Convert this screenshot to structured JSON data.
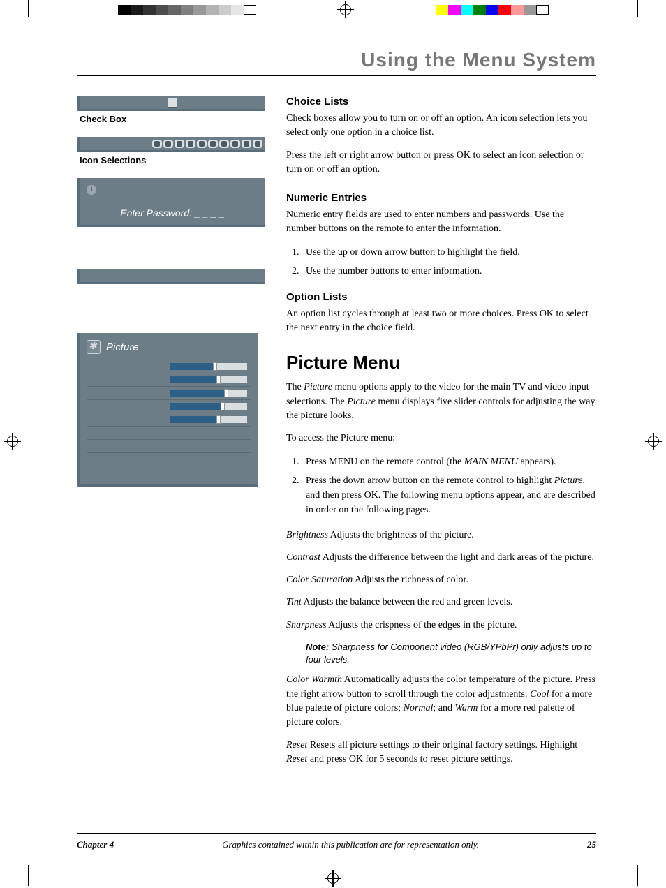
{
  "chapter_title": "Using the Menu System",
  "widgets": {
    "checkbox_caption": "Check Box",
    "icon_caption": "Icon Selections",
    "password_label": "Enter Password: _ _ _ _"
  },
  "picture_widget": {
    "title": "Picture",
    "sliders": [
      55,
      60,
      70,
      65,
      60
    ]
  },
  "sections": {
    "choice": {
      "heading": "Choice Lists",
      "p1": "Check boxes allow you to turn on or off an option. An icon selection lets you select only one option in a choice list.",
      "p2": "Press the left or right arrow button or press OK to select an icon selection or turn on or off an option."
    },
    "numeric": {
      "heading": "Numeric Entries",
      "p1": "Numeric entry fields are used to enter numbers and passwords. Use the number buttons on the remote to enter the information.",
      "step1": "Use the up or down arrow button to highlight the field.",
      "step2": "Use the number buttons to enter information."
    },
    "option": {
      "heading": "Option Lists",
      "p1": "An option list cycles through at least two or more choices. Press OK to select the next entry in the choice field."
    }
  },
  "picture_menu": {
    "heading": "Picture Menu",
    "intro_a": "The ",
    "intro_b": "Picture",
    "intro_c": " menu options apply to the video for the main TV and video input selections. The ",
    "intro_d": "Picture",
    "intro_e": " menu displays five slider controls for adjusting the way the picture looks.",
    "access": "To access the Picture menu:",
    "step1_a": "Press MENU on the remote control (the ",
    "step1_b": "MAIN MENU",
    "step1_c": " appears).",
    "step2_a": "Press the down arrow button on the remote control to highlight ",
    "step2_b": "Picture,",
    "step2_c": " and then press OK. The following menu options appear, and are described in order on the following pages.",
    "items": {
      "brightness_l": "Brightness",
      "brightness_t": "   Adjusts the brightness of the picture.",
      "contrast_l": "Contrast",
      "contrast_t": "   Adjusts the difference between the light and dark areas of the picture.",
      "color_l": "Color Saturation",
      "color_t": "   Adjusts the richness of color.",
      "tint_l": "Tint",
      "tint_t": "  Adjusts the balance between the red and green levels.",
      "sharp_l": "Sharpness",
      "sharp_t": "   Adjusts the crispness of the edges in the picture.",
      "note_b": "Note:",
      "note_t": " Sharpness for Component video (RGB/YPbPr) only adjusts up to four levels.",
      "warmth_l": "Color Warmth",
      "warmth_t1": "   Automatically adjusts the color temperature of the picture. Press the right arrow button to scroll through the color adjustments: ",
      "warmth_cool": "Cool",
      "warmth_t2": " for a more blue palette of picture colors; ",
      "warmth_normal": "Normal",
      "warmth_t3": "; and ",
      "warmth_warm": "Warm",
      "warmth_t4": " for a more red palette of picture colors.",
      "reset_l": "Reset",
      "reset_t1": "   Resets all picture settings to their original factory settings. Highlight ",
      "reset_i": "Reset",
      "reset_t2": " and press OK for 5 seconds to reset picture settings."
    }
  },
  "footer": {
    "chapter": "Chapter 4",
    "mid": "Graphics contained within this publication are for representation only.",
    "page": "25"
  }
}
